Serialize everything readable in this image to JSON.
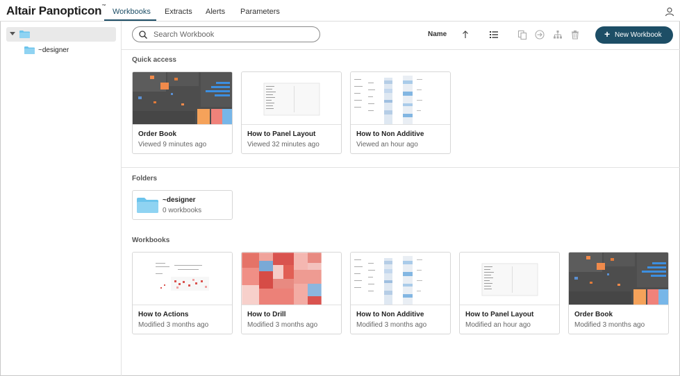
{
  "app": {
    "brand": "Altair Panopticon"
  },
  "nav": {
    "tabs": [
      {
        "label": "Workbooks",
        "active": true
      },
      {
        "label": "Extracts"
      },
      {
        "label": "Alerts"
      },
      {
        "label": "Parameters"
      }
    ]
  },
  "sidebar": {
    "root_icon": "folder-icon",
    "children": [
      {
        "label": "~designer"
      }
    ]
  },
  "toolbar": {
    "search_placeholder": "Search Workbook",
    "sort_label": "Name",
    "new_button_label": "New Workbook",
    "icons": [
      "sort-ascending-icon",
      "list-view-icon",
      "copy-icon",
      "move-icon",
      "hierarchy-icon",
      "delete-icon"
    ]
  },
  "quick_access": {
    "title": "Quick access",
    "items": [
      {
        "title": "Order Book",
        "subtitle": "Viewed 9 minutes ago",
        "thumb": "treemap-dark"
      },
      {
        "title": "How to Panel Layout",
        "subtitle": "Viewed 32 minutes ago",
        "thumb": "panel-layout"
      },
      {
        "title": "How to Non Additive",
        "subtitle": "Viewed an hour ago",
        "thumb": "non-additive"
      }
    ]
  },
  "folders": {
    "title": "Folders",
    "items": [
      {
        "name": "~designer",
        "count": "0 workbooks"
      }
    ]
  },
  "workbooks": {
    "title": "Workbooks",
    "items": [
      {
        "title": "How to Actions",
        "subtitle": "Modified 3 months ago",
        "thumb": "actions"
      },
      {
        "title": "How to Drill",
        "subtitle": "Modified 3 months ago",
        "thumb": "treemap-red"
      },
      {
        "title": "How to Non Additive",
        "subtitle": "Modified 3 months ago",
        "thumb": "non-additive"
      },
      {
        "title": "How to Panel Layout",
        "subtitle": "Modified an hour ago",
        "thumb": "panel-layout"
      },
      {
        "title": "Order Book",
        "subtitle": "Modified 3 months ago",
        "thumb": "treemap-dark"
      }
    ]
  },
  "colors": {
    "accent": "#1d4e66",
    "folder": "#6cc4ec"
  }
}
